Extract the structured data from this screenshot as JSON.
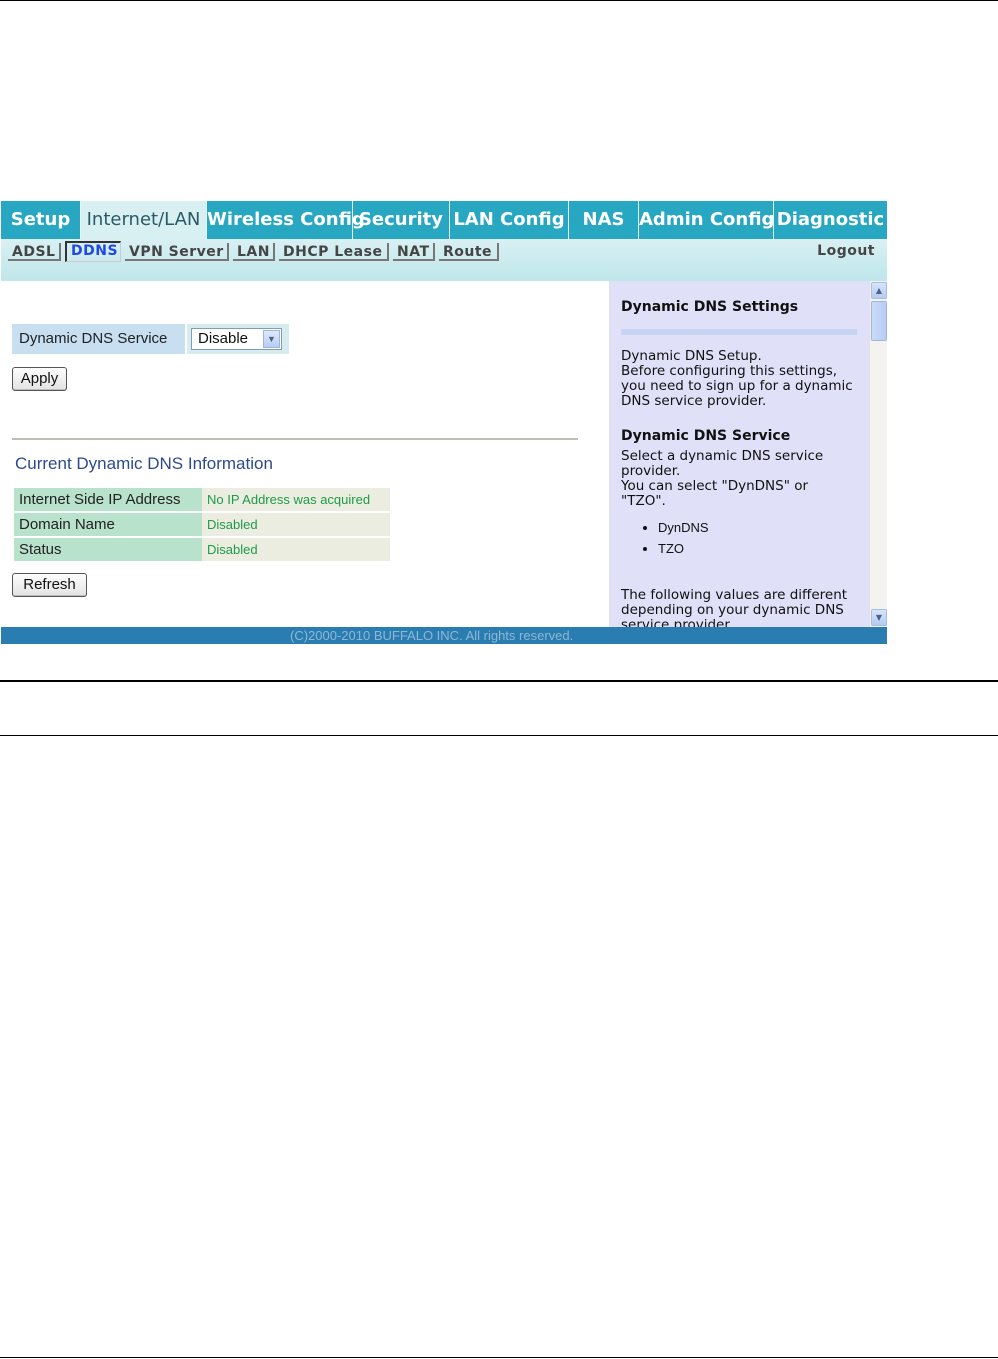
{
  "main_nav": [
    "Setup",
    "Internet/LAN",
    "Wireless Config",
    "Security",
    "LAN Config",
    "NAS",
    "Admin Config",
    "Diagnostic"
  ],
  "sub_nav": [
    "ADSL",
    "DDNS",
    "VPN Server",
    "LAN",
    "DHCP Lease",
    "NAT",
    "Route"
  ],
  "logout": "Logout",
  "ddns": {
    "service_label": "Dynamic DNS Service",
    "service_value": "Disable",
    "apply_label": "Apply"
  },
  "info": {
    "title": "Current Dynamic DNS Information",
    "rows": [
      {
        "key": "Internet Side IP Address",
        "value": "No IP Address was acquired"
      },
      {
        "key": "Domain Name",
        "value": "Disabled"
      },
      {
        "key": "Status",
        "value": "Disabled"
      }
    ],
    "refresh_label": "Refresh"
  },
  "help": {
    "title": "Dynamic DNS Settings",
    "intro": "Dynamic DNS Setup.\nBefore configuring this settings, you need to sign up for a dynamic DNS service provider.",
    "service_title": "Dynamic DNS Service",
    "service_text": "Select a dynamic DNS service provider.\nYou can select \"DynDNS\" or \"TZO\".",
    "providers": [
      "DynDNS",
      "TZO"
    ],
    "more_text": "The following values are different depending on your dynamic DNS service provider."
  },
  "footer": "(C)2000-2010 BUFFALO INC. All rights reserved."
}
